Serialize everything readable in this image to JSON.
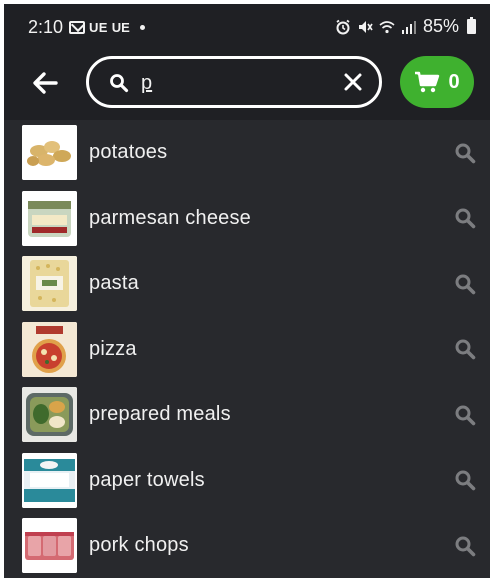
{
  "status_bar": {
    "time": "2:10",
    "carrier1": "UE",
    "carrier2": "UE",
    "battery": "85%"
  },
  "header": {
    "search": {
      "value": "p"
    },
    "cart": {
      "count": "0",
      "color": "#3fb12f"
    }
  },
  "suggestions": [
    {
      "label": "potatoes",
      "icon": "search-icon"
    },
    {
      "label": "parmesan cheese",
      "icon": "search-icon"
    },
    {
      "label": "pasta",
      "icon": "search-icon"
    },
    {
      "label": "pizza",
      "icon": "search-icon"
    },
    {
      "label": "prepared meals",
      "icon": "search-icon"
    },
    {
      "label": "paper towels",
      "icon": "search-icon"
    },
    {
      "label": "pork chops",
      "icon": "search-icon"
    }
  ]
}
